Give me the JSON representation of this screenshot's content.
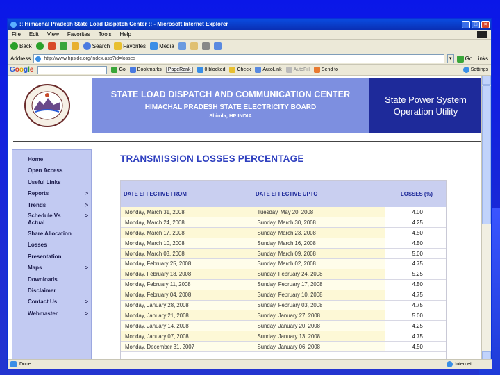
{
  "window": {
    "title": ":: Himachal Pradesh State Load Dispatch Center :: - Microsoft Internet Explorer",
    "menu": [
      "File",
      "Edit",
      "View",
      "Favorites",
      "Tools",
      "Help"
    ],
    "toolbar": {
      "back": "Back",
      "search": "Search",
      "favorites": "Favorites",
      "media": "Media"
    },
    "address": {
      "label": "Address",
      "url": "http://www.hpsldc.org/index.asp?id=losses",
      "go": "Go",
      "links": "Links"
    },
    "googlebar": {
      "go": "Go",
      "bookmarks": "Bookmarks",
      "pagerank": "PageRank",
      "blocked": "0 blocked",
      "check": "Check",
      "autolink": "AutoLink",
      "autofill": "AutoFill",
      "sendto": "Send to",
      "settings": "Settings"
    },
    "status": {
      "done": "Done",
      "zone": "Internet"
    }
  },
  "header": {
    "title": "STATE LOAD DISPATCH AND COMMUNICATION CENTER",
    "subtitle": "HIMACHAL PRADESH STATE ELECTRICITY BOARD",
    "location": "Shimla, HP INDIA",
    "right_line1": "State Power System",
    "right_line2": "Operation Utility"
  },
  "sidebar": {
    "items": [
      {
        "label": "Home",
        "chev": ""
      },
      {
        "label": "Open Access",
        "chev": ""
      },
      {
        "label": "Useful Links",
        "chev": ""
      },
      {
        "label": "Reports",
        "chev": ">"
      },
      {
        "label": "Trends",
        "chev": ">"
      },
      {
        "label": "Schedule Vs Actual",
        "chev": ">"
      },
      {
        "label": "Share Allocation",
        "chev": ""
      },
      {
        "label": "Losses",
        "chev": ""
      },
      {
        "label": "Presentation",
        "chev": ""
      },
      {
        "label": "Maps",
        "chev": ">"
      },
      {
        "label": "Downloads",
        "chev": ""
      },
      {
        "label": "Disclaimer",
        "chev": ""
      },
      {
        "label": "Contact Us",
        "chev": ">"
      },
      {
        "label": "Webmaster",
        "chev": ">"
      }
    ]
  },
  "main": {
    "title": "TRANSMISSION LOSSES PERCENTAGE",
    "columns": [
      "DATE EFFECTIVE FROM",
      "DATE EFFECTIVE UPTO",
      "LOSSES (%)"
    ],
    "rows": [
      [
        "Monday, March 31, 2008",
        "Tuesday, May 20, 2008",
        "4.00"
      ],
      [
        "Monday, March 24, 2008",
        "Sunday, March 30, 2008",
        "4.25"
      ],
      [
        "Monday, March 17, 2008",
        "Sunday, March 23, 2008",
        "4.50"
      ],
      [
        "Monday, March 10, 2008",
        "Sunday, March 16, 2008",
        "4.50"
      ],
      [
        "Monday, March 03, 2008",
        "Sunday, March 09, 2008",
        "5.00"
      ],
      [
        "Monday, February 25, 2008",
        "Sunday, March 02, 2008",
        "4.75"
      ],
      [
        "Monday, February 18, 2008",
        "Sunday, February 24, 2008",
        "5.25"
      ],
      [
        "Monday, February 11, 2008",
        "Sunday, February 17, 2008",
        "4.50"
      ],
      [
        "Monday, February 04, 2008",
        "Sunday, February 10, 2008",
        "4.75"
      ],
      [
        "Monday, January 28, 2008",
        "Sunday, February 03, 2008",
        "4.75"
      ],
      [
        "Monday, January 21, 2008",
        "Sunday, January 27, 2008",
        "5.00"
      ],
      [
        "Monday, January 14, 2008",
        "Sunday, January 20, 2008",
        "4.25"
      ],
      [
        "Monday, January 07, 2008",
        "Sunday, January 13, 2008",
        "4.75"
      ],
      [
        "Monday, December 31, 2007",
        "Sunday, January 06, 2008",
        "4.50"
      ]
    ]
  },
  "colors": {
    "slide_bg": "#1a2ad6",
    "header_center": "#7d8fe0",
    "header_right": "#1e2a9a",
    "sidebar": "#c2caf2",
    "content_title": "#2e3fbf",
    "row_odd": "#fdf8d6",
    "row_even": "#fffdea"
  }
}
